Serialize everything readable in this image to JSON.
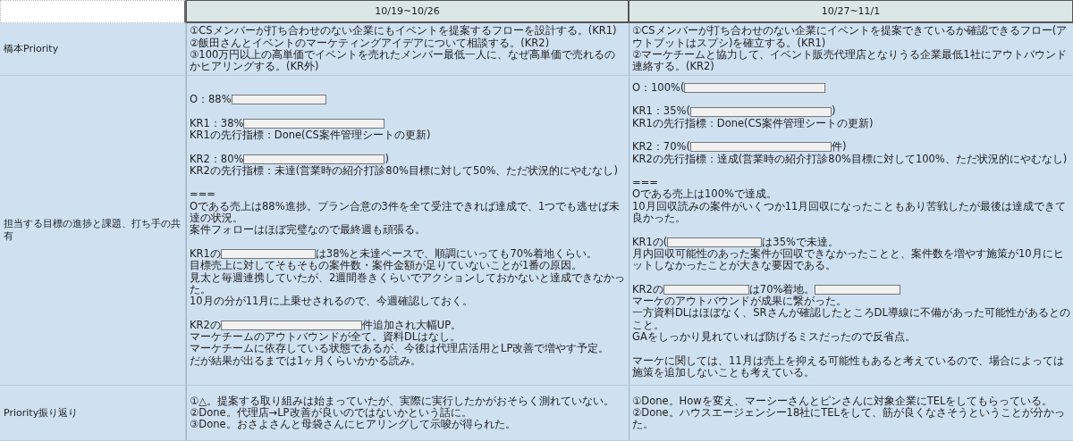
{
  "table": {
    "columns": [
      {
        "label": "10/19~10/26"
      },
      {
        "label": "10/27~11/1"
      }
    ],
    "rows": [
      {
        "label": "橋本Priority",
        "cells": [
          [
            [
              {
                "kind": "text",
                "text": "①CSメンバーが打ち合わせのない企業にもイベントを提案するフローを設計する。(KR1)"
              }
            ],
            [
              {
                "kind": "text",
                "text": "②飯田さんとイベントのマーケティングアイデアについて相談する。(KR2)"
              }
            ],
            [
              {
                "kind": "text",
                "text": "③100万円以上の高単価でイベントを売れたメンバー最低一人に、なぜ高単価で売れるのかヒアリングする。(KR外)"
              }
            ]
          ],
          [
            [
              {
                "kind": "text",
                "text": "①CSメンバーが打ち合わせのない企業にイベントを提案できているか確認できるフロー(アウトプットはスプシ)を確立する。(KR1)"
              }
            ],
            [
              {
                "kind": "text",
                "text": "②マーケチームと協力して、イベント販売代理店となりうる企業最低1社にアウトバウンド連絡する。(KR2)"
              }
            ]
          ]
        ]
      },
      {
        "label": "担当する目標の進捗と課題、打ち手の共有",
        "cells": [
          [
            [],
            [
              {
                "kind": "text",
                "text": "O：88%"
              },
              {
                "kind": "mask-s"
              }
            ],
            [],
            [
              {
                "kind": "text",
                "text": "KR1：38%"
              },
              {
                "kind": "mask-l"
              }
            ],
            [
              {
                "kind": "text",
                "text": "KR1の先行指標：Done(CS案件管理シートの更新)"
              }
            ],
            [],
            [
              {
                "kind": "text",
                "text": "KR2：80%"
              },
              {
                "kind": "mask-l"
              },
              {
                "kind": "text",
                "text": ")"
              }
            ],
            [
              {
                "kind": "text",
                "text": "KR2の先行指標：未達(営業時の紹介打診80%目標に対して50%、ただ状況的にやむなし)"
              }
            ],
            [],
            [
              {
                "kind": "text",
                "text": "==="
              }
            ],
            [
              {
                "kind": "text",
                "text": "Oである売上は88%進捗。プラン合意の3件を全て受注できれば達成で、1つでも逃せば未達の状況。"
              }
            ],
            [
              {
                "kind": "text",
                "text": "案件フォローはほぼ完璧なので最終週も頑張る。"
              }
            ],
            [],
            [
              {
                "kind": "text",
                "text": "KR1の"
              },
              {
                "kind": "mask-s"
              },
              {
                "kind": "text",
                "text": "は38%と未達ペースで、順調にいっても70%着地くらい。"
              }
            ],
            [
              {
                "kind": "text",
                "text": "目標売上に対してそもそもの案件数・案件金額が足りていないことが1番の原因。"
              }
            ],
            [
              {
                "kind": "text",
                "text": "見太と毎週連携していたが、2週間巻きくらいでアクションしておかないと達成できなかった。"
              }
            ],
            [
              {
                "kind": "text",
                "text": "10月の分が11月に上乗せされるので、今週確認しておく。"
              }
            ],
            [],
            [
              {
                "kind": "text",
                "text": "KR2の"
              },
              {
                "kind": "mask-l"
              },
              {
                "kind": "text",
                "text": "件追加され大幅UP。"
              }
            ],
            [
              {
                "kind": "text",
                "text": "マーケチームのアウトバウンドが全て。資料DLはなし。"
              }
            ],
            [
              {
                "kind": "text",
                "text": "マーケチームに依存している状態であるが、今後は代理店活用とLP改善で増やす予定。"
              }
            ],
            [
              {
                "kind": "text",
                "text": "だが結果が出るまでは1ヶ月くらいかかる読み。"
              }
            ],
            []
          ],
          [
            [
              {
                "kind": "text",
                "text": "O：100%("
              },
              {
                "kind": "mask-l"
              }
            ],
            [],
            [
              {
                "kind": "text",
                "text": "KR1：35%("
              },
              {
                "kind": "mask-l"
              },
              {
                "kind": "text",
                "text": ")"
              }
            ],
            [
              {
                "kind": "text",
                "text": "KR1の先行指標：Done(CS案件管理シートの更新)"
              }
            ],
            [],
            [
              {
                "kind": "text",
                "text": "KR2：70%("
              },
              {
                "kind": "mask-l"
              },
              {
                "kind": "text",
                "text": "件)"
              }
            ],
            [
              {
                "kind": "text",
                "text": "KR2の先行指標：達成(営業時の紹介打診80%目標に対して100%、ただ状況的にやむなし)"
              }
            ],
            [],
            [
              {
                "kind": "text",
                "text": "==="
              }
            ],
            [
              {
                "kind": "text",
                "text": "Oである売上は100%で達成。"
              }
            ],
            [
              {
                "kind": "text",
                "text": "10月回収読みの案件がいくつか11月回収になったこともあり苦戦したが最後は達成できて良かった。"
              }
            ],
            [],
            [
              {
                "kind": "text",
                "text": "KR1の("
              },
              {
                "kind": "mask-s"
              },
              {
                "kind": "text",
                "text": "は35%で未達。"
              }
            ],
            [
              {
                "kind": "text",
                "text": "月内回収可能性のあった案件が回収できなかったことと、案件数を増やす施策が10月にヒットしなかったことが大きな要因である。"
              }
            ],
            [],
            [
              {
                "kind": "text",
                "text": "KR2の"
              },
              {
                "kind": "mask-m"
              },
              {
                "kind": "text",
                "text": "は70%着地。"
              },
              {
                "kind": "mask-m"
              }
            ],
            [
              {
                "kind": "text",
                "text": "マーケのアウトバウンドが成果に繋がった。"
              }
            ],
            [
              {
                "kind": "text",
                "text": "一方資料DLはほぼなく、SRさんが確認したところDL導線に不備があった可能性があるとのこと。"
              }
            ],
            [
              {
                "kind": "text",
                "text": "GAをしっかり見れていれば防げるミスだったので反省点。"
              }
            ],
            [],
            [
              {
                "kind": "text",
                "text": "マーケに関しては、11月は売上を抑える可能性もあると考えているので、場合によっては施策を追加しないことも考えている。"
              }
            ]
          ]
        ]
      },
      {
        "label": "Priority振り返り",
        "cells": [
          [
            [
              {
                "kind": "text",
                "text": "①△。提案する取り組みは始まっていたが、実際に実行したかがおそらく測れていない。"
              }
            ],
            [
              {
                "kind": "text",
                "text": "②Done。代理店→LP改善が良いのではないかという話に。"
              }
            ],
            [
              {
                "kind": "text",
                "text": "③Done。おさよさんと母袋さんにヒアリングして示唆が得られた。"
              }
            ]
          ],
          [
            [
              {
                "kind": "text",
                "text": "①Done。Howを変え、マーシーさんとピンさんに対象企業にTELをしてもらっている。"
              }
            ],
            [
              {
                "kind": "text",
                "text": "②Done。ハウスエージェンシー18社にTELをして、筋が良くなさそうということが分かった。"
              }
            ]
          ]
        ]
      }
    ]
  }
}
